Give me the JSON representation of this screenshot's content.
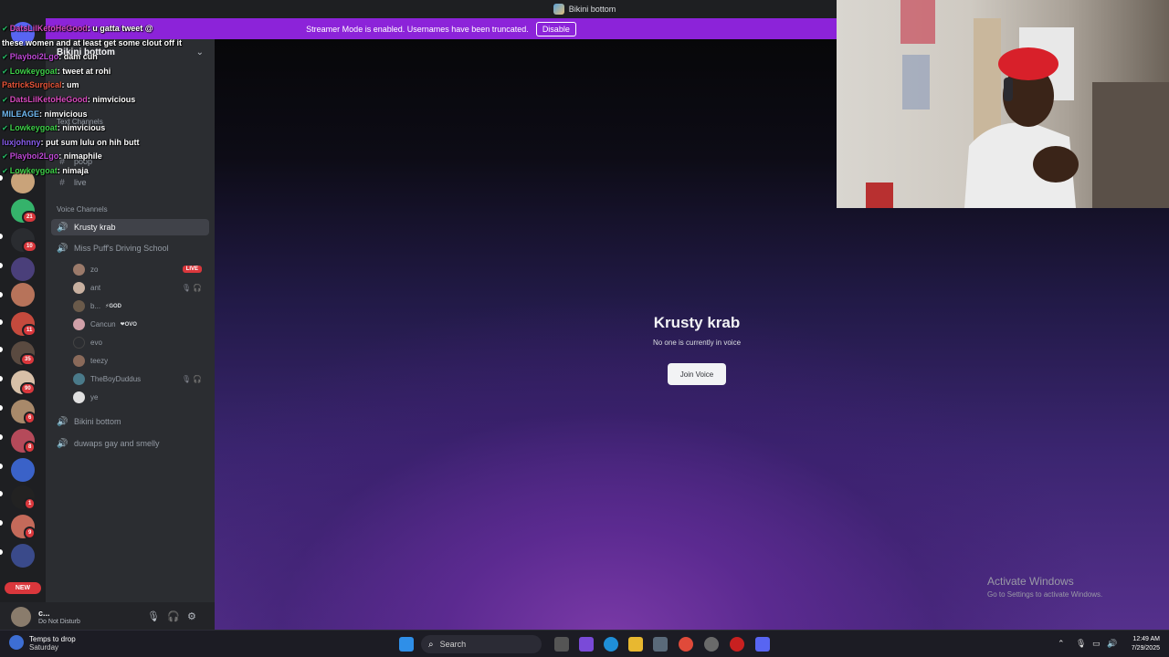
{
  "window": {
    "title": "Bikini bottom"
  },
  "streamer_banner": {
    "message": "Streamer Mode is enabled. Usernames have been truncated.",
    "disable_label": "Disable"
  },
  "server": {
    "name": "Bikini bottom",
    "categories": {
      "text": "Text Channels",
      "voice": "Voice Channels"
    },
    "text_channels": [
      "poop",
      "live"
    ],
    "voice_channels": [
      {
        "name": "Krusty krab"
      },
      {
        "name": "Miss Puff's Driving School"
      },
      {
        "name": "Bikini bottom"
      },
      {
        "name": "duwaps gay and smelly"
      }
    ],
    "voice_users": [
      {
        "name": "zo",
        "tag": "",
        "live": "LIVE"
      },
      {
        "name": "ant",
        "tag": ""
      },
      {
        "name": "b...",
        "tag": "⚡GOD"
      },
      {
        "name": "Cancun",
        "tag": "❤OVO"
      },
      {
        "name": "evo",
        "tag": ""
      },
      {
        "name": "teezy",
        "tag": ""
      },
      {
        "name": "TheBoyDuddus",
        "tag": ""
      },
      {
        "name": "ye",
        "tag": ""
      }
    ]
  },
  "server_rail": {
    "badges": [
      "21",
      "10",
      "11",
      "35",
      "90",
      "6",
      "8",
      "1",
      "9"
    ],
    "new_label": "NEW"
  },
  "user_panel": {
    "name": "c...",
    "status": "Do Not Disturb"
  },
  "main": {
    "channel_title": "Krusty krab",
    "subtitle": "No one is currently in voice",
    "join_label": "Join Voice"
  },
  "activate_windows": {
    "title": "Activate Windows",
    "subtitle": "Go to Settings to activate Windows."
  },
  "chat_overlay": [
    {
      "user": "DatsLilKetoHeGood",
      "color": "#d94cc0",
      "text": ": u gatta tweet @"
    },
    {
      "user": "",
      "color": "#ffffff",
      "text": "these women and at least get some clout off it"
    },
    {
      "user": "Playboi2Lgo",
      "color": "#c04ad8",
      "text": ": dam cuh"
    },
    {
      "user": "Lowkeygoat",
      "color": "#3fd14a",
      "text": ": tweet at rohi"
    },
    {
      "user": "PatrickSurgical",
      "color": "#e8553a",
      "text": ": um"
    },
    {
      "user": "DatsLilKetoHeGood",
      "color": "#d94cc0",
      "text": ": nimvicious"
    },
    {
      "user": "MILEAGE",
      "color": "#6fb8f0",
      "text": ": nimvicious"
    },
    {
      "user": "Lowkeygoat",
      "color": "#3fd14a",
      "text": ": nimvicious"
    },
    {
      "user": "luxjohnny",
      "color": "#8a5ef0",
      "text": ": put sum lulu on hih butt"
    },
    {
      "user": "Playboi2Lgo",
      "color": "#c04ad8",
      "text": ": nimaphile"
    },
    {
      "user": "Lowkeygoat",
      "color": "#3fd14a",
      "text": ": nimaja"
    }
  ],
  "taskbar": {
    "weather_title": "Temps to drop",
    "weather_sub": "Saturday",
    "search_placeholder": "Search",
    "time": "12:49 AM",
    "date": "7/29/2025"
  },
  "colors": {
    "streamer_banner": "#8c23d9",
    "sidebar": "#2b2d31",
    "rail": "#1e1f22",
    "selected_channel": "#404249",
    "live_badge": "#da373c"
  }
}
